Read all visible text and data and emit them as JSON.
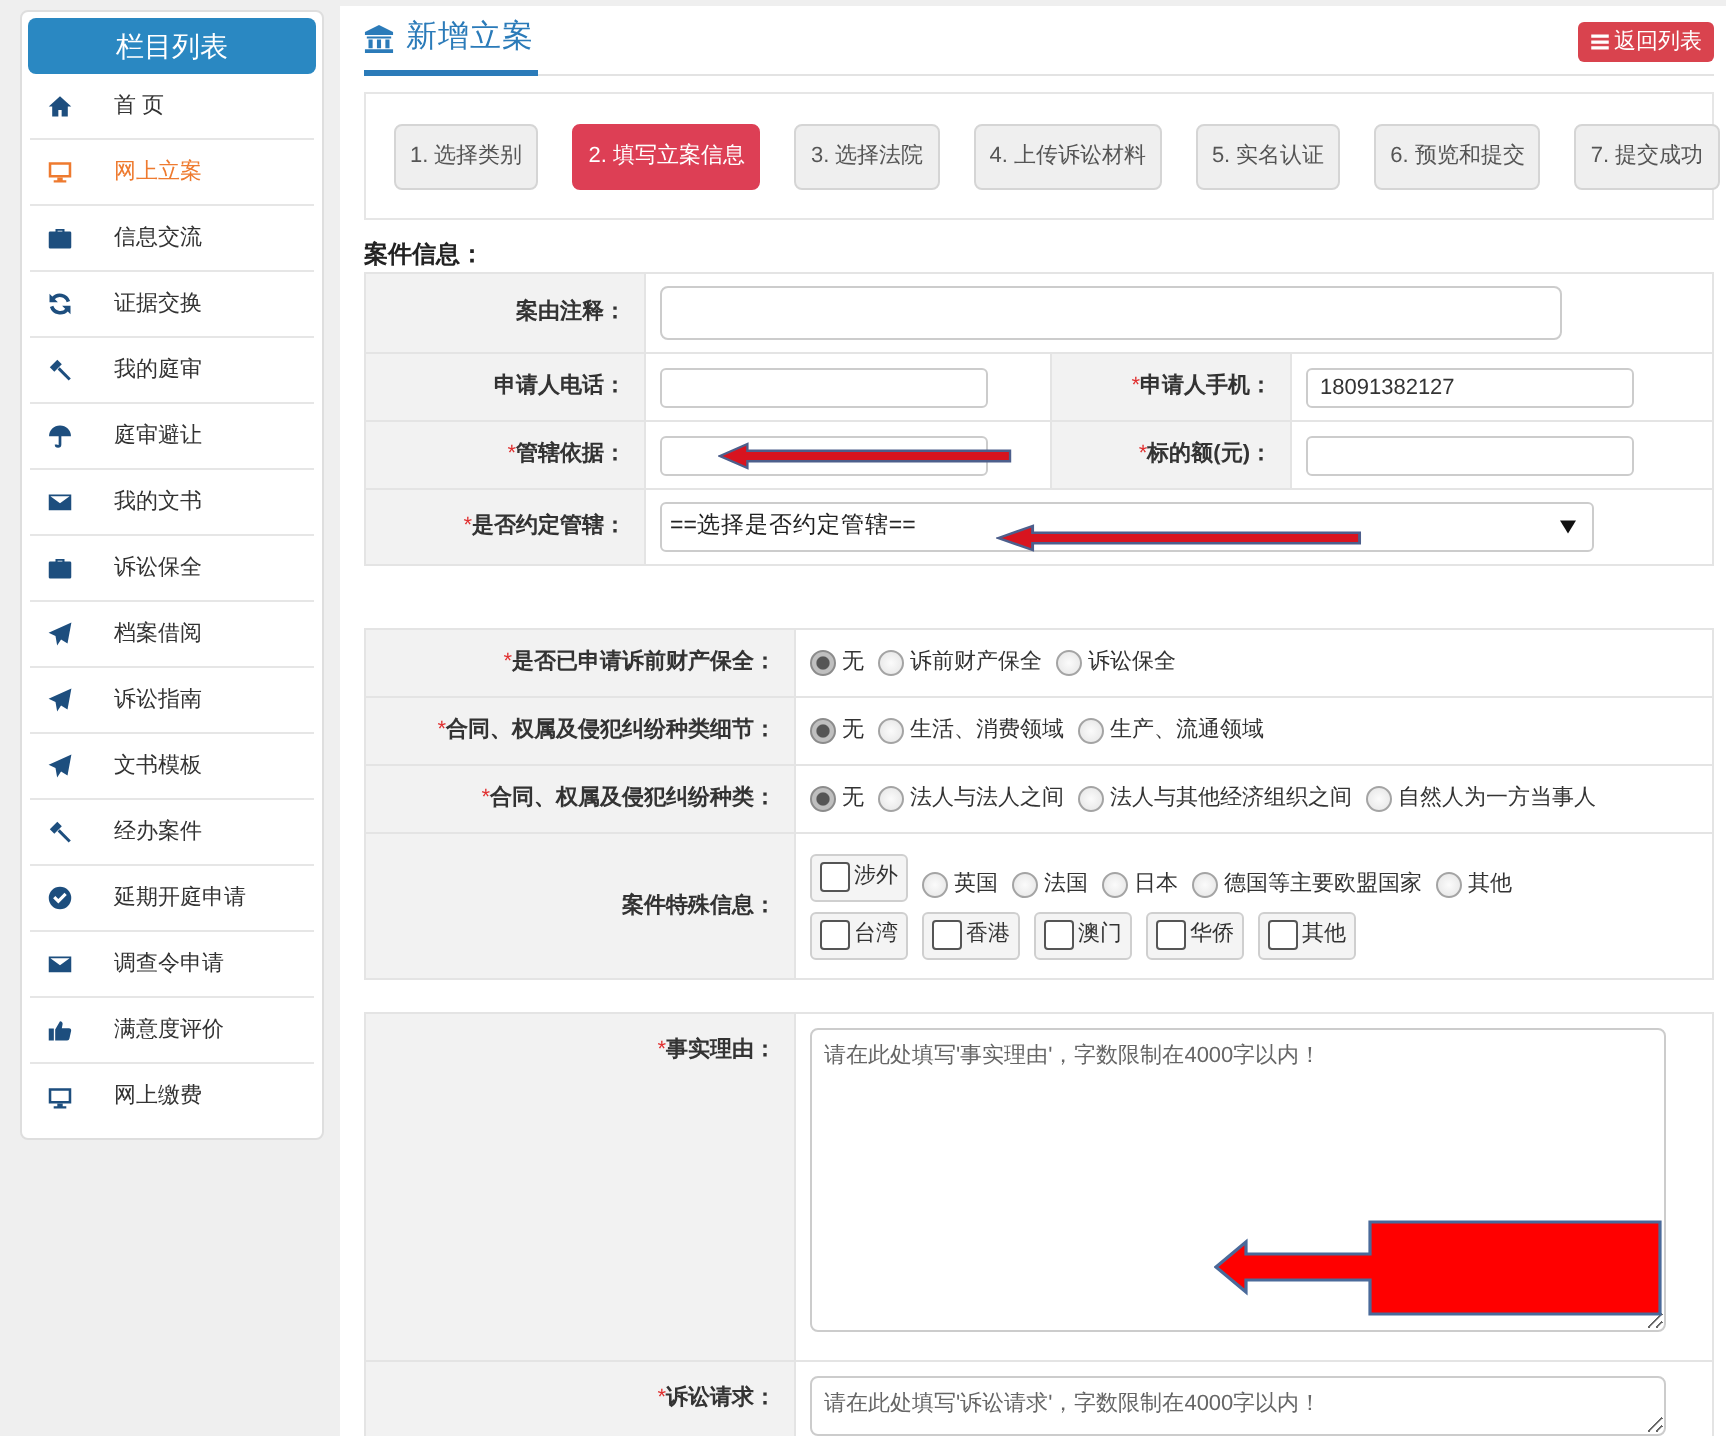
{
  "sidebar": {
    "title": "栏目列表",
    "items": [
      {
        "kind": "home",
        "label": "首 页",
        "selected": false
      },
      {
        "kind": "desktop",
        "label": "网上立案",
        "selected": true
      },
      {
        "kind": "briefcase",
        "label": "信息交流",
        "selected": false
      },
      {
        "kind": "refresh",
        "label": "证据交换",
        "selected": false
      },
      {
        "kind": "gavel",
        "label": "我的庭审",
        "selected": false
      },
      {
        "kind": "umbrella",
        "label": "庭审避让",
        "selected": false
      },
      {
        "kind": "envelope",
        "label": "我的文书",
        "selected": false
      },
      {
        "kind": "briefcase",
        "label": "诉讼保全",
        "selected": false
      },
      {
        "kind": "plane",
        "label": "档案借阅",
        "selected": false
      },
      {
        "kind": "plane",
        "label": "诉讼指南",
        "selected": false
      },
      {
        "kind": "plane",
        "label": "文书模板",
        "selected": false
      },
      {
        "kind": "gavel",
        "label": "经办案件",
        "selected": false
      },
      {
        "kind": "check",
        "label": "延期开庭申请",
        "selected": false
      },
      {
        "kind": "envelope",
        "label": "调查令申请",
        "selected": false
      },
      {
        "kind": "thumbs",
        "label": "满意度评价",
        "selected": false
      },
      {
        "kind": "desktop",
        "label": "网上缴费",
        "selected": false
      }
    ]
  },
  "page": {
    "title": "新增立案",
    "return_button": "返回列表"
  },
  "steps": [
    {
      "label": "1. 选择类别",
      "selected": false
    },
    {
      "label": "2. 填写立案信息",
      "selected": true
    },
    {
      "label": "3. 选择法院",
      "selected": false
    },
    {
      "label": "4. 上传诉讼材料",
      "selected": false
    },
    {
      "label": "5. 实名认证",
      "selected": false
    },
    {
      "label": "6. 预览和提交",
      "selected": false
    },
    {
      "label": "7. 提交成功",
      "selected": false
    }
  ],
  "case_info": {
    "title": "案件信息：",
    "rows": [
      {
        "cells": [
          {
            "label": "案由注释：",
            "kind": "wide-input"
          }
        ]
      },
      {
        "cells": [
          {
            "label": "申请人电话：",
            "kind": "input"
          },
          {
            "label": "申请人手机：",
            "required_mark": "*",
            "kind": "input",
            "value": "18091382127"
          }
        ]
      },
      {
        "cells": [
          {
            "label": "管辖依据：",
            "required_mark": "*",
            "kind": "input",
            "annotation": {
              "kind": "thin-arrow"
            }
          },
          {
            "label": "标的额(元)：",
            "required_mark": "*",
            "kind": "input"
          }
        ]
      },
      {
        "cells": [
          {
            "label": "是否约定管辖：",
            "required_mark": "*",
            "kind": "select",
            "value": "==选择是否约定管辖==",
            "annotation": {
              "kind": "thin-arrow"
            }
          }
        ]
      }
    ]
  },
  "classification": {
    "rows": [
      {
        "label": "是否已申请诉前财产保全：",
        "required_mark": "*",
        "lines": [
          [
            {
              "kind": "radio",
              "label": "无",
              "selected": true
            },
            {
              "kind": "radio",
              "label": "诉前财产保全",
              "selected": false
            },
            {
              "kind": "radio",
              "label": "诉讼保全",
              "selected": false
            }
          ]
        ]
      },
      {
        "label": "合同、权属及侵犯纠纷种类细节：",
        "required_mark": "*",
        "lines": [
          [
            {
              "kind": "radio",
              "label": "无",
              "selected": true
            },
            {
              "kind": "radio",
              "label": "生活、消费领域",
              "selected": false
            },
            {
              "kind": "radio",
              "label": "生产、流通领域",
              "selected": false
            }
          ]
        ]
      },
      {
        "label": "合同、权属及侵犯纠纷种类：",
        "required_mark": "*",
        "lines": [
          [
            {
              "kind": "radio",
              "label": "无",
              "selected": true
            },
            {
              "kind": "radio",
              "label": "法人与法人之间",
              "selected": false
            },
            {
              "kind": "radio",
              "label": "法人与其他经济组织之间",
              "selected": false
            },
            {
              "kind": "radio",
              "label": "自然人为一方当事人",
              "selected": false
            }
          ]
        ]
      },
      {
        "label": "案件特殊信息：",
        "lines": [
          [
            {
              "kind": "checkbox",
              "label": "涉外",
              "checked": false
            },
            {
              "kind": "radio",
              "label": "英国",
              "selected": false
            },
            {
              "kind": "radio",
              "label": "法国",
              "selected": false
            },
            {
              "kind": "radio",
              "label": "日本",
              "selected": false
            },
            {
              "kind": "radio",
              "label": "德国等主要欧盟国家",
              "selected": false
            },
            {
              "kind": "radio",
              "label": "其他",
              "selected": false
            }
          ],
          [
            {
              "kind": "checkbox",
              "label": "台湾",
              "checked": false
            },
            {
              "kind": "checkbox",
              "label": "香港",
              "checked": false
            },
            {
              "kind": "checkbox",
              "label": "澳门",
              "checked": false
            },
            {
              "kind": "checkbox",
              "label": "华侨",
              "checked": false
            },
            {
              "kind": "checkbox",
              "label": "其他",
              "checked": false
            }
          ]
        ]
      }
    ]
  },
  "statements": {
    "rows": [
      {
        "label": "事实理由：",
        "required_mark": "*",
        "placeholder": "请在此处填写'事实理由'，字数限制在4000字以内！",
        "annotation": {
          "kind": "block-arrow"
        }
      },
      {
        "label": "诉讼请求：",
        "required_mark": "*",
        "placeholder": "请在此处填写'诉讼请求'，字数限制在4000字以内！"
      }
    ]
  }
}
